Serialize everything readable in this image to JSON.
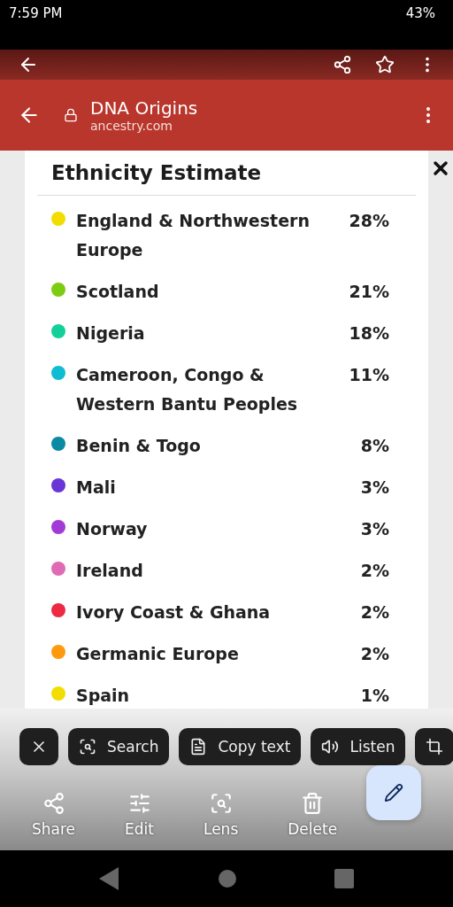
{
  "status_bar": {
    "time": "7:59 PM",
    "battery": "43%"
  },
  "browser_bar": {
    "title": "DNA Origins",
    "url": "ancestry.com"
  },
  "card": {
    "title": "Ethnicity Estimate",
    "regions": [
      {
        "name": "England & Northwestern Europe",
        "percent": "28%",
        "color": "#f2dd00"
      },
      {
        "name": "Scotland",
        "percent": "21%",
        "color": "#7ccc12"
      },
      {
        "name": "Nigeria",
        "percent": "18%",
        "color": "#13d09b"
      },
      {
        "name": "Cameroon, Congo & Western Bantu Peoples",
        "percent": "11%",
        "color": "#0fbcd2"
      },
      {
        "name": "Benin & Togo",
        "percent": "8%",
        "color": "#0a8aa3"
      },
      {
        "name": "Mali",
        "percent": "3%",
        "color": "#6a35d6"
      },
      {
        "name": "Norway",
        "percent": "3%",
        "color": "#a23bd6"
      },
      {
        "name": "Ireland",
        "percent": "2%",
        "color": "#e06bb5"
      },
      {
        "name": "Ivory Coast & Ghana",
        "percent": "2%",
        "color": "#ec2a43"
      },
      {
        "name": "Germanic Europe",
        "percent": "2%",
        "color": "#ff9a0e"
      },
      {
        "name": "Spain",
        "percent": "1%",
        "color": "#f2dd00"
      }
    ]
  },
  "chips": [
    {
      "kind": "close"
    },
    {
      "kind": "search",
      "label": "Search"
    },
    {
      "kind": "copy",
      "label": "Copy text"
    },
    {
      "kind": "listen",
      "label": "Listen"
    },
    {
      "kind": "crop"
    }
  ],
  "actions": [
    {
      "kind": "share",
      "label": "Share"
    },
    {
      "kind": "edit",
      "label": "Edit"
    },
    {
      "kind": "lens",
      "label": "Lens"
    },
    {
      "kind": "delete",
      "label": "Delete"
    }
  ]
}
